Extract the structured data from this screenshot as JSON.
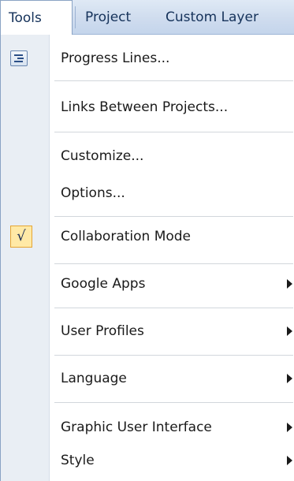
{
  "menubar": {
    "items": [
      {
        "label": "Tools",
        "active": true
      },
      {
        "label": "Project",
        "active": false
      },
      {
        "label": "Custom Layer",
        "active": false
      }
    ]
  },
  "menu": {
    "items": [
      {
        "label": "Progress Lines...",
        "icon": "progress-lines-icon"
      },
      {
        "label": "Links Between Projects..."
      },
      {
        "label": "Customize..."
      },
      {
        "label": "Options..."
      },
      {
        "label": "Collaboration Mode",
        "checked": true,
        "check_glyph": "√"
      },
      {
        "label": "Google Apps",
        "submenu": true
      },
      {
        "label": "User Profiles",
        "submenu": true
      },
      {
        "label": "Language",
        "submenu": true
      },
      {
        "label": "Graphic User Interface",
        "submenu": true
      },
      {
        "label": "Style",
        "submenu": true
      }
    ]
  },
  "colors": {
    "menubar_bg": "#cfdcee",
    "gutter_bg": "#e9eef4",
    "check_bg": "#ffe9a6",
    "check_border": "#e4a535"
  }
}
